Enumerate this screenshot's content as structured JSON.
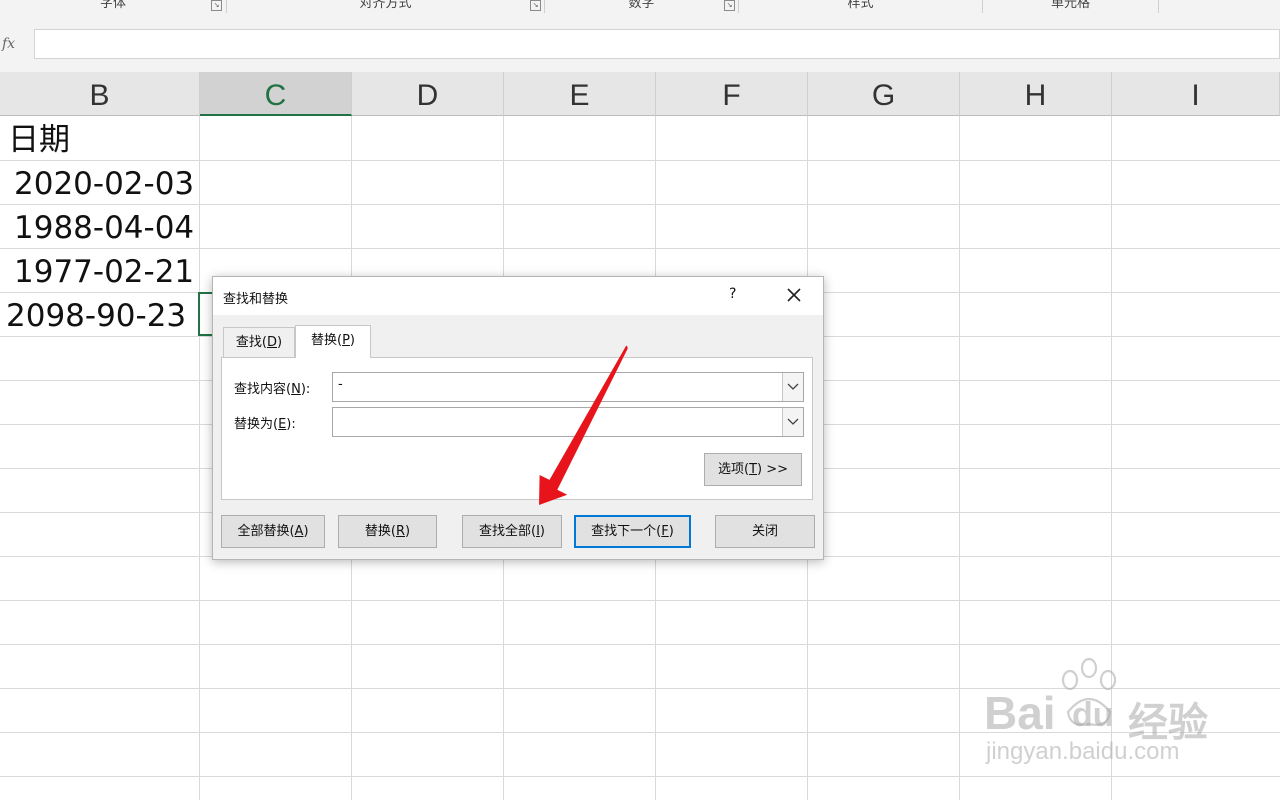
{
  "ribbon": {
    "groups": [
      {
        "label": "字体"
      },
      {
        "label": "对齐方式"
      },
      {
        "label": "数字"
      },
      {
        "label": "样式"
      },
      {
        "label": "单元格"
      }
    ]
  },
  "formula_bar": {
    "fx_label": "fx",
    "value": ""
  },
  "sheet": {
    "columns": [
      "B",
      "C",
      "D",
      "E",
      "F",
      "G",
      "H",
      "I"
    ],
    "selected_column": "C",
    "cells": {
      "b1": "日期",
      "b2": "2020-02-03",
      "b3": "1988-04-04",
      "b4": "1977-02-21",
      "b5": "2098-90-23"
    }
  },
  "dialog": {
    "title": "查找和替换",
    "help": "?",
    "tabs": {
      "find": {
        "text": "查找(",
        "key": "D",
        "end": ")"
      },
      "replace": {
        "text": "替换(",
        "key": "P",
        "end": ")"
      }
    },
    "find_what": {
      "label": "查找内容(",
      "key": "N",
      "end": "):",
      "value": "-"
    },
    "replace_with": {
      "label": "替换为(",
      "key": "E",
      "end": "):",
      "value": ""
    },
    "options_button": {
      "text": "选项(",
      "key": "T",
      "end": ") >>"
    },
    "buttons": {
      "replace_all": {
        "text": "全部替换(",
        "key": "A",
        "end": ")"
      },
      "replace": {
        "text": "替换(",
        "key": "R",
        "end": ")"
      },
      "find_all": {
        "text": "查找全部(",
        "key": "I",
        "end": ")"
      },
      "find_next": {
        "text": "查找下一个(",
        "key": "F",
        "end": ")"
      },
      "close": {
        "text": "关闭"
      }
    }
  },
  "annotation": {
    "arrow_color": "#e8141c"
  },
  "watermark": {
    "brand_left": "Bai",
    "brand_right": "du",
    "brand_cn": "经验",
    "url": "jingyan.baidu.com"
  },
  "colors": {
    "excel_green": "#217346",
    "focus_blue": "#0078d7"
  }
}
